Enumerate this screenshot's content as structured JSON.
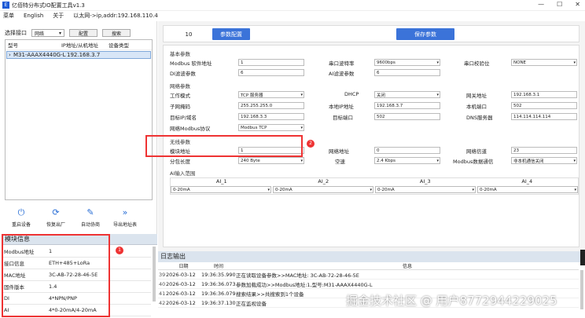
{
  "window": {
    "title": "亿佰特分布式IO配置工具v1.3",
    "icon_letter": "E"
  },
  "menu": [
    "菜单",
    "English",
    "关于",
    "以太网->ip,addr:192.168.110.4"
  ],
  "left": {
    "port_label": "选择接口",
    "port_value": "网络",
    "config_btn": "配置",
    "search_btn": "搜索",
    "device_headers": [
      "型号",
      "IP地址/从机地址",
      "设备类型"
    ],
    "device_row": {
      "model": "M31-AAAX4440G-L",
      "ip": "192.168.3.7"
    },
    "tools": [
      {
        "label": "重启设备",
        "icon": "power-icon"
      },
      {
        "label": "恢复出厂",
        "icon": "refresh-icon"
      },
      {
        "label": "自动协商",
        "icon": "edit-icon"
      },
      {
        "label": "导出地址表",
        "icon": "double-chevron-icon"
      }
    ]
  },
  "module": {
    "title": "模块信息",
    "rows": [
      {
        "k": "Modbus地址",
        "v": "1"
      },
      {
        "k": "接口信息",
        "v": "ETH+485+LoRa"
      },
      {
        "k": "MAC地址",
        "v": "3C-AB-72-28-46-5E"
      },
      {
        "k": "固件版本",
        "v": "1.4"
      },
      {
        "k": "DI",
        "v": "4*NPN/PNP"
      },
      {
        "k": "AI",
        "v": "4*0-20mA/4-20mA"
      }
    ]
  },
  "top": {
    "number": "10",
    "param_btn": "参数配置",
    "save_btn": "保存参数"
  },
  "basic": {
    "title": "基本参数",
    "modbus_addr_label": "Modbus 软件地址",
    "modbus_addr": "1",
    "baud_label": "串口波特率",
    "baud": "9600bps",
    "parity_label": "串口校验位",
    "parity": "NONE",
    "di_label": "DI滤波参数",
    "di": "6",
    "ai_label": "AI滤波参数",
    "ai": "6"
  },
  "net": {
    "title": "网络参数",
    "mode_label": "工作模式",
    "mode": "TCP 服务器",
    "dhcp_label": "DHCP",
    "dhcp": "关闭",
    "gw_label": "网关地址",
    "gw": "192.168.3.1",
    "mask_label": "子网掩码",
    "mask": "255.255.255.0",
    "localip_label": "本地IP地址",
    "localip": "192.168.3.7",
    "localport_label": "本机端口",
    "localport": "502",
    "target_label": "目标IP/域名",
    "target": "192.168.3.3",
    "targetport_label": "目标端口",
    "targetport": "502",
    "dns_label": "DNS服务器",
    "dns": "114.114.114.114",
    "proto_label": "网络Modbus协议",
    "proto": "Modbus TCP"
  },
  "wireless": {
    "title": "无线参数",
    "addr_label": "模块地址",
    "addr": "1",
    "netaddr_label": "网络地址",
    "netaddr": "0",
    "channel_label": "网络信道",
    "channel": "23",
    "packet_label": "分包长度",
    "packet": "240 Byte",
    "airrate_label": "空速",
    "airrate": "2.4 Kbps",
    "mbmode_label": "Modbus数据通信",
    "mbmode": "非本机通信关闭"
  },
  "ai_range": {
    "title": "AI输入范围",
    "headers": [
      "AI_1",
      "AI_2",
      "AI_3",
      "AI_4"
    ],
    "values": [
      "0-20mA",
      "0-20mA",
      "0-20mA",
      "0-20mA"
    ]
  },
  "log": {
    "title": "日志输出",
    "headers": [
      "日期",
      "时间",
      "信息"
    ],
    "rows": [
      {
        "n": "39",
        "d": "2026-03-12",
        "t": "19:36:35.990",
        "m": "正在读取设备参数>>MAC地址: 3C-AB-72-28-46-5E"
      },
      {
        "n": "40",
        "d": "2026-03-12",
        "t": "19:36:36.073",
        "m": "参数加载成功>>Modbus地址:1,型号:M31-AAAX4440G-L"
      },
      {
        "n": "41",
        "d": "2026-03-12",
        "t": "19:36:36.079",
        "m": "搜索结果>>共搜索到1个设备"
      },
      {
        "n": "42",
        "d": "2026-03-12",
        "t": "19:36:37.130",
        "m": "正在监视设备"
      }
    ]
  },
  "badges": [
    "1",
    "2"
  ],
  "watermark": "掘金技术社区 @ 用户8772944229025"
}
